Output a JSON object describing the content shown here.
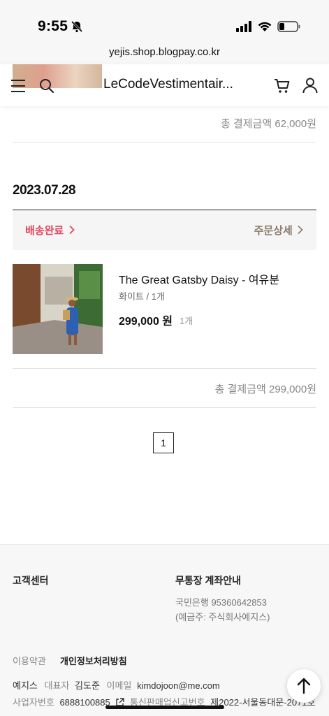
{
  "status_bar": {
    "time": "9:55"
  },
  "browser": {
    "url": "yejis.shop.blogpay.co.kr"
  },
  "header": {
    "brand": "LeCodeVestimentair..."
  },
  "previous_order": {
    "total": "총 결제금액 62,000원"
  },
  "order": {
    "date": "2023.07.28",
    "status": "배송완료",
    "detail_link": "주문상세",
    "item": {
      "name": "The Great Gatsby Daisy - 여유분",
      "option": "화이트 / 1개",
      "price": "299,000 원",
      "quantity": "1개"
    },
    "total": "총 결제금액 299,000원"
  },
  "pagination": {
    "current": "1"
  },
  "footer": {
    "customer_center": "고객센터",
    "bank_title": "무통장 계좌안내",
    "bank_line": "국민은행 95360642853",
    "holder_line": "(예금주: 주식회사예지스)",
    "terms": "이용약관",
    "privacy": "개인정보처리방침",
    "company": "예지스",
    "ceo_label": "대표자",
    "ceo": "김도준",
    "email_label": "이메일",
    "email": "kimdojoon@me.com",
    "biz_label": "사업자번호",
    "biz_no": "6888100885",
    "mail_order_label": "통신판매업신고번호",
    "mail_order_no": "제2022-서울동대문-2071호"
  }
}
